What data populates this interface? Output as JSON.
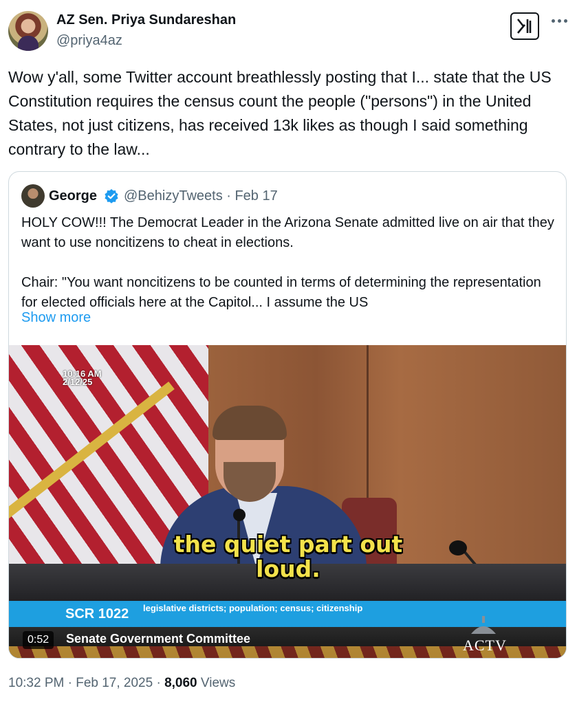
{
  "author": {
    "display_name": "AZ Sen. Priya Sundareshan",
    "handle": "@priya4az"
  },
  "header_actions": {
    "grok_icon": "grok-icon",
    "more_icon": "more-horizontal-icon"
  },
  "tweet": {
    "text": "Wow y'all, some Twitter account breathlessly posting that I... state that the US Constitution requires the census count the people (\"persons\") in the United States, not just citizens, has received 13k likes as though I said something contrary to the law..."
  },
  "quote": {
    "name": "George",
    "verified_icon": "verified-badge-icon",
    "handle_date": "@BehizyTweets · Feb 17",
    "paragraph1": "HOLY COW!!! The Democrat Leader in the Arizona Senate admitted live on air that they want to use noncitizens to cheat in elections.",
    "paragraph2": "Chair: \"You want noncitizens to be counted in terms of determining the representation for elected officials here at the Capitol... I assume the US",
    "show_more": "Show more"
  },
  "video": {
    "timestamp_time": "10:16 AM",
    "timestamp_date": "2/12/25",
    "caption_line1": "the quiet part out",
    "caption_line2": "loud.",
    "chyron_code": "SCR 1022",
    "chyron_desc": "legislative districts; population; census; citizenship",
    "committee": "Senate Government Committee",
    "duration": "0:52",
    "network": "ACTV"
  },
  "footer": {
    "time": "10:32 PM · Feb 17, 2025 · ",
    "views_count": "8,060",
    "views_label": " Views"
  },
  "colors": {
    "link": "#1d9bf0",
    "secondary_text": "#536471",
    "caption_yellow": "#f3e24b",
    "chyron_blue": "#1e9fe0"
  }
}
